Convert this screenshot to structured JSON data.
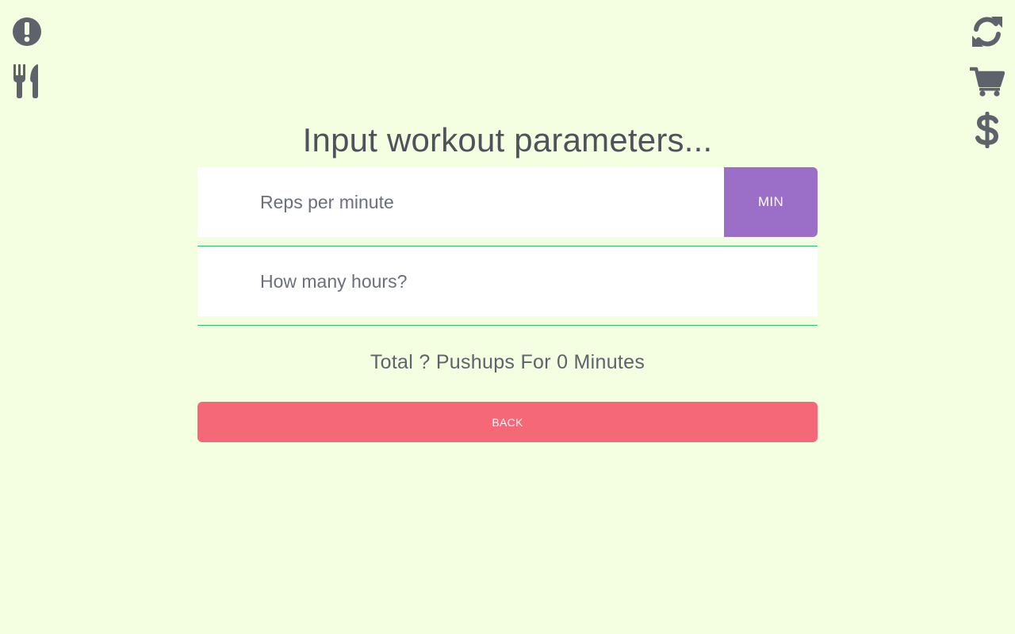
{
  "colors": {
    "background": "#f3ffe0",
    "icon": "#5d636b",
    "unit_button": "#9b6fc7",
    "back_button": "#f46877",
    "divider": "#2fbf6a"
  },
  "left_icons": [
    "alert-icon",
    "utensils-icon"
  ],
  "right_icons": [
    "refresh-icon",
    "cart-icon",
    "dollar-icon"
  ],
  "title": "Input workout parameters...",
  "form": {
    "reps": {
      "placeholder": "Reps per minute",
      "value": "",
      "unit_label": "MIN"
    },
    "hours": {
      "placeholder": "How many hours?",
      "value": ""
    }
  },
  "summary": "Total ? Pushups For 0 Minutes",
  "back_label": "BACK"
}
